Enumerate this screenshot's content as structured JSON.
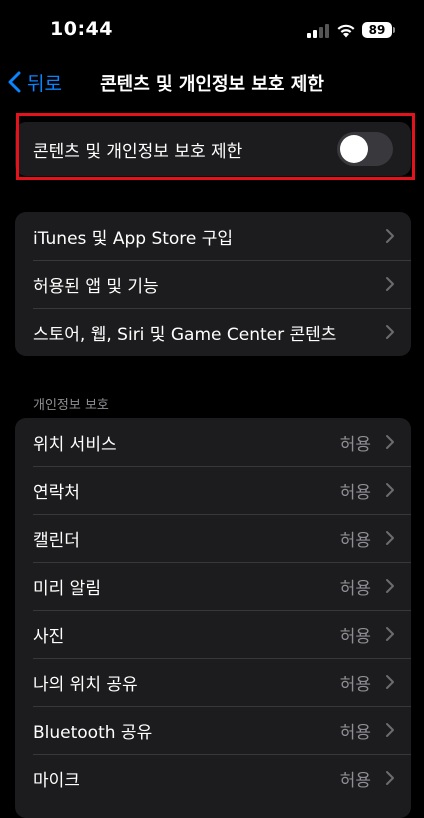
{
  "status": {
    "time": "10:44",
    "battery": "89"
  },
  "nav": {
    "back_label": "뒤로",
    "title": "콘텐츠 및 개인정보 보호 제한"
  },
  "toggle_row": {
    "label": "콘텐츠 및 개인정보 보호 제한",
    "enabled": false
  },
  "restrictions": [
    {
      "label": "iTunes 및 App Store 구입"
    },
    {
      "label": "허용된 앱 및 기능"
    },
    {
      "label": "스토어, 웹, Siri 및 Game Center 콘텐츠"
    }
  ],
  "privacy": {
    "header": "개인정보 보호",
    "items": [
      {
        "label": "위치 서비스",
        "value": "허용"
      },
      {
        "label": "연락처",
        "value": "허용"
      },
      {
        "label": "캘린더",
        "value": "허용"
      },
      {
        "label": "미리 알림",
        "value": "허용"
      },
      {
        "label": "사진",
        "value": "허용"
      },
      {
        "label": "나의 위치 공유",
        "value": "허용"
      },
      {
        "label": "Bluetooth 공유",
        "value": "허용"
      },
      {
        "label": "마이크",
        "value": "허용"
      }
    ]
  },
  "colors": {
    "accent": "#0a84ff",
    "highlight": "#e3121b",
    "cell": "#1c1c1e"
  }
}
